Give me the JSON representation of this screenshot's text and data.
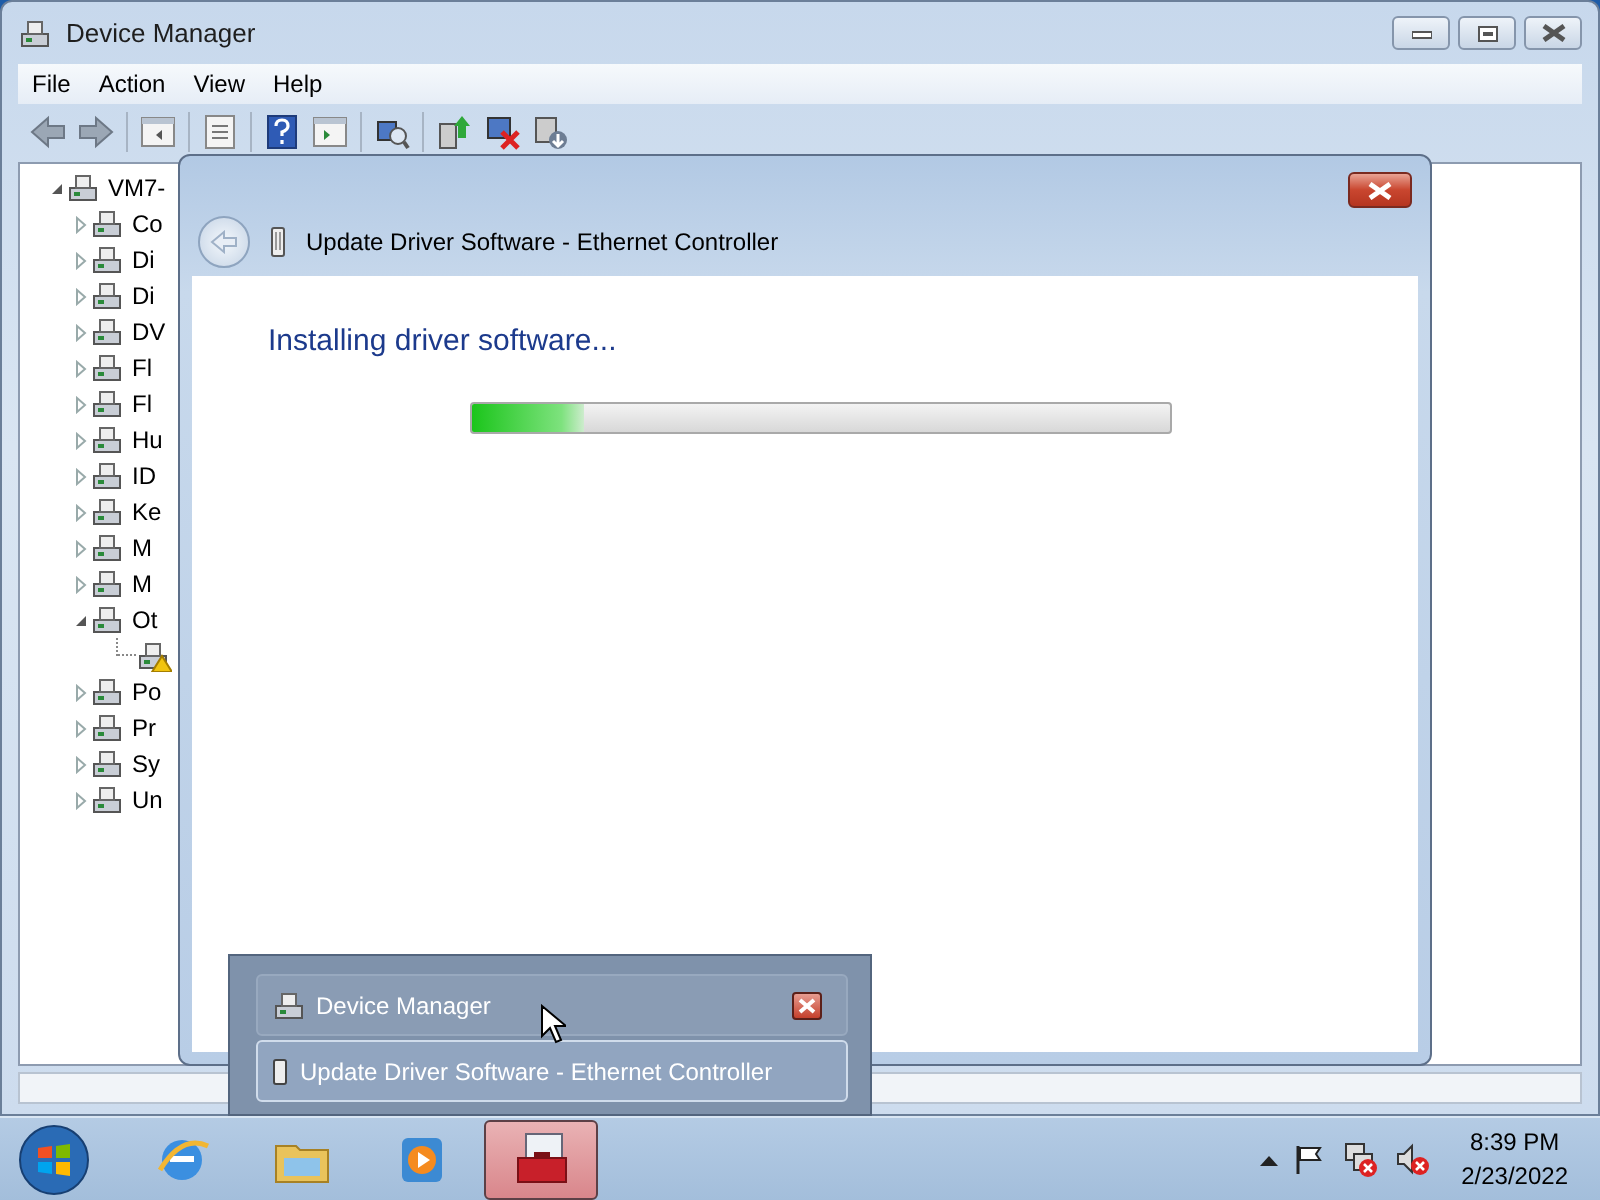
{
  "window": {
    "title": "Device Manager"
  },
  "menu": [
    "File",
    "Action",
    "View",
    "Help"
  ],
  "tree": {
    "label": "VM7-",
    "expanded": true,
    "warning": false,
    "children": [
      {
        "label": "Co",
        "expanded": false,
        "warning": false
      },
      {
        "label": "Di",
        "expanded": false,
        "warning": false
      },
      {
        "label": "Di",
        "expanded": false,
        "warning": false
      },
      {
        "label": "DV",
        "expanded": false,
        "warning": false
      },
      {
        "label": "Fl",
        "expanded": false,
        "warning": false
      },
      {
        "label": "Fl",
        "expanded": false,
        "warning": false
      },
      {
        "label": "Hu",
        "expanded": false,
        "warning": false
      },
      {
        "label": "ID",
        "expanded": false,
        "warning": false
      },
      {
        "label": "Ke",
        "expanded": false,
        "warning": false
      },
      {
        "label": "M",
        "expanded": false,
        "warning": false
      },
      {
        "label": "M",
        "expanded": false,
        "warning": false
      },
      {
        "label": "Ot",
        "expanded": true,
        "warning": false,
        "children": [
          {
            "warning": true
          }
        ]
      },
      {
        "label": "Po",
        "expanded": false,
        "warning": false
      },
      {
        "label": "Pr",
        "expanded": false,
        "warning": false
      },
      {
        "label": "Sy",
        "expanded": false,
        "warning": false
      },
      {
        "label": "Un",
        "expanded": false,
        "warning": false
      }
    ]
  },
  "dialog": {
    "title": "Update Driver Software - Ethernet Controller",
    "heading": "Installing driver software...",
    "progress": {
      "level": 0.16
    }
  },
  "thumbnail_popup": {
    "items": [
      {
        "title": "Device Manager",
        "hovered": true,
        "selected": false
      },
      {
        "title": "Update Driver Software - Ethernet Controller",
        "hovered": false,
        "selected": true
      }
    ]
  },
  "taskbar": {
    "apps": [
      {
        "kind": "browser",
        "selected": false
      },
      {
        "kind": "folder",
        "selected": false
      },
      {
        "kind": "player",
        "selected": false
      },
      {
        "kind": "toolbox",
        "selected": true
      }
    ]
  },
  "clock": {
    "time": "8:39 PM",
    "date": "2/23/2022"
  }
}
